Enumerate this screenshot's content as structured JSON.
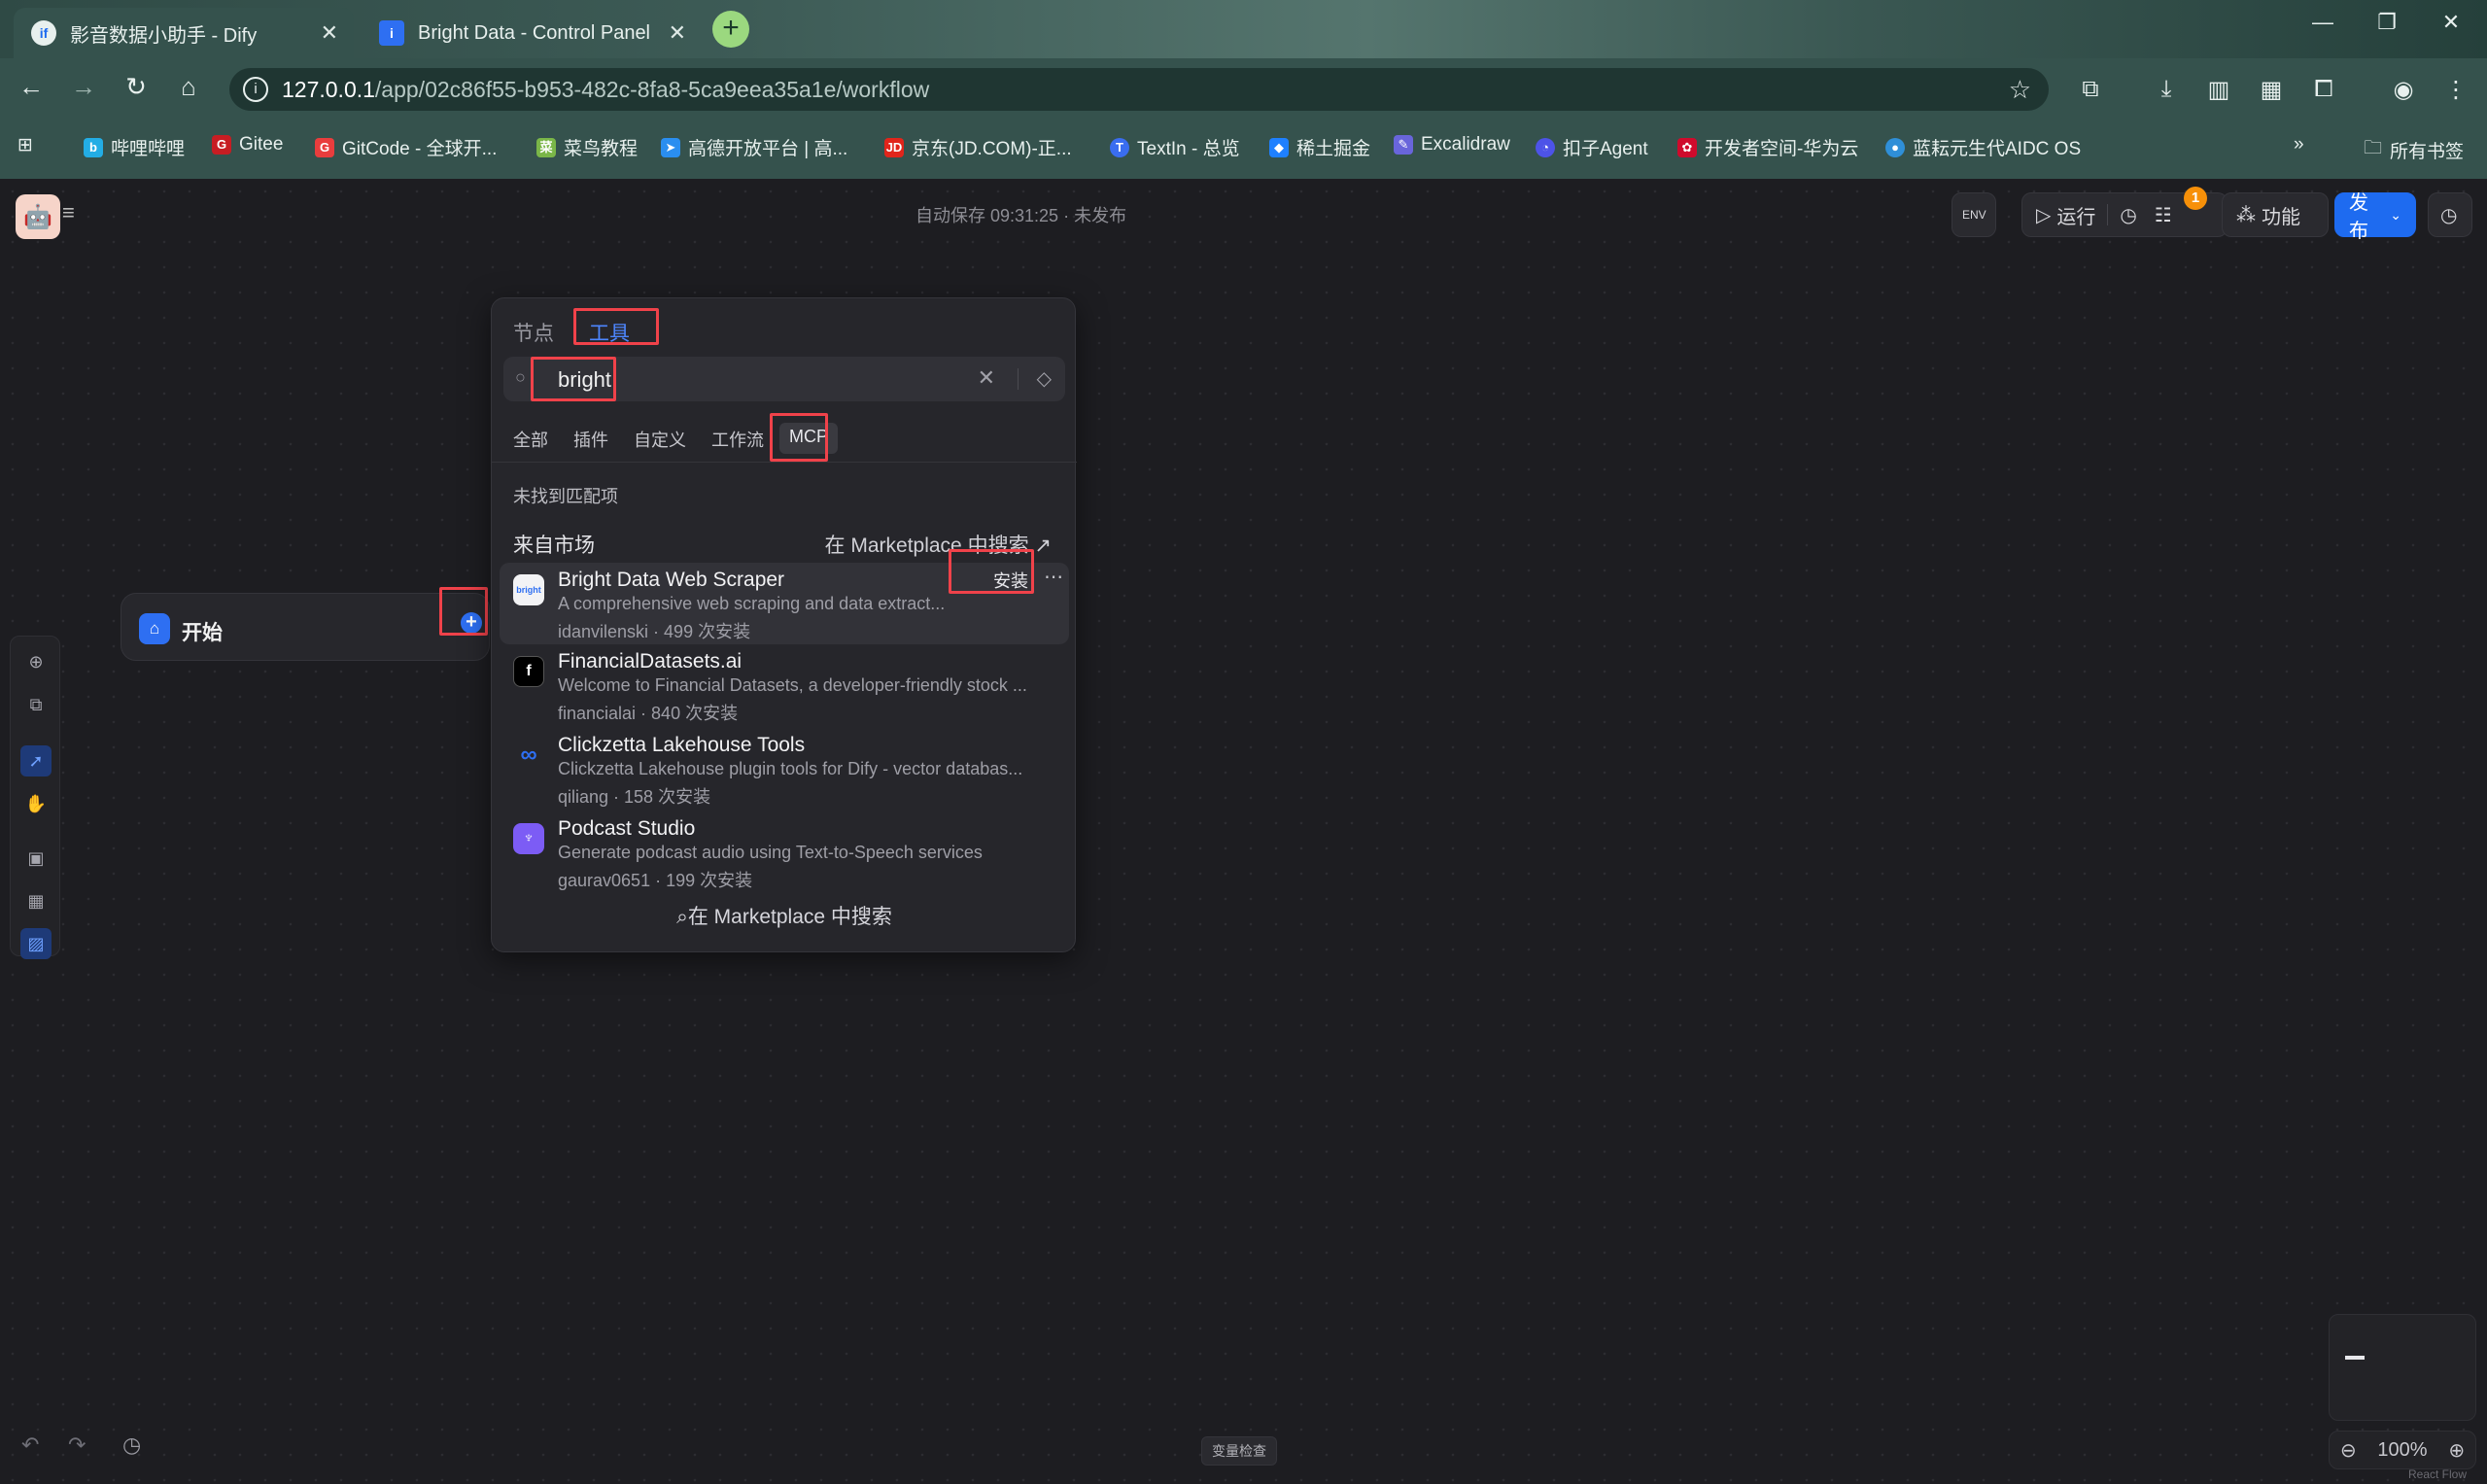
{
  "browser": {
    "tabs": [
      {
        "title": "影音数据小助手 - Dify",
        "icon": "dify-icon",
        "active": true
      },
      {
        "title": "Bright Data - Control Panel",
        "icon": "brightdata-icon",
        "active": false
      }
    ],
    "url": {
      "host": "127.0.0.1",
      "path": "/app/02c86f55-b953-482c-8fa8-5ca9eea35a1e/workflow"
    },
    "bookmarks": [
      "哔哩哔哩",
      "Gitee",
      "GitCode - 全球开...",
      "菜鸟教程",
      "高德开放平台 | 高...",
      "京东(JD.COM)-正...",
      "TextIn - 总览",
      "稀土掘金",
      "Excalidraw",
      "扣子Agent",
      "开发者空间-华为云",
      "蓝耘元生代AIDC OS"
    ],
    "all_bookmarks": "所有书签"
  },
  "app": {
    "autosave": "自动保存 09:31:25 · 未发布",
    "env_label": "ENV",
    "run_label": "运行",
    "badge_count": "1",
    "features_label": "功能",
    "publish_label": "发布",
    "start_node": "开始",
    "variable_check": "变量检查",
    "zoom": "100%",
    "react_flow": "React Flow"
  },
  "panel": {
    "tabs": [
      "节点",
      "工具"
    ],
    "active_tab": "工具",
    "search_value": "bright",
    "categories": [
      "全部",
      "插件",
      "自定义",
      "工作流",
      "MCP"
    ],
    "selected_category": "MCP",
    "no_match": "未找到匹配项",
    "marketplace_heading": "来自市场",
    "marketplace_link": "在 Marketplace 中搜索 ↗",
    "install_label": "安装",
    "items": [
      {
        "name": "Bright Data Web Scraper",
        "desc": "A comprehensive web scraping and data extract...",
        "meta": "idanvilenski · 499 次安装",
        "icon": "brightdata-icon"
      },
      {
        "name": "FinancialDatasets.ai",
        "desc": "Welcome to Financial Datasets, a developer-friendly stock ...",
        "meta": "financialai · 840 次安装",
        "icon": "financial-icon"
      },
      {
        "name": "Clickzetta Lakehouse Tools",
        "desc": "Clickzetta Lakehouse plugin tools for Dify - vector databas...",
        "meta": "qiliang · 158 次安装",
        "icon": "clickzetta-icon"
      },
      {
        "name": "Podcast Studio",
        "desc": "Generate podcast audio using Text-to-Speech services",
        "meta": "gaurav0651 · 199 次安装",
        "icon": "podcast-icon"
      }
    ],
    "footer_search": "在 Marketplace 中搜索"
  },
  "colors": {
    "accent": "#1e6bf0",
    "highlight": "#f0424a",
    "badge": "#f79009"
  }
}
